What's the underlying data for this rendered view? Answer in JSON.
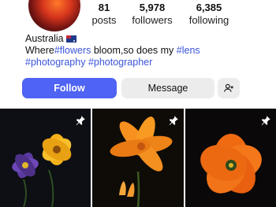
{
  "profile": {
    "stats": [
      {
        "value": "81",
        "label": "posts"
      },
      {
        "value": "5,978",
        "label": "followers"
      },
      {
        "value": "6,385",
        "label": "following"
      }
    ],
    "bio": {
      "location": "Australia",
      "line2_prefix": "Where",
      "line2_tag1": "#flowers",
      "line2_mid": " bloom,so does my ",
      "line2_tag2": "#lens",
      "line3_tag1": "#photography",
      "line3_tag2": "#photographer"
    }
  },
  "actions": {
    "follow_label": "Follow",
    "message_label": "Message",
    "add_user_icon": "person-add-icon"
  },
  "posts": [
    {
      "subject": "purple and yellow flowers",
      "pinned": true
    },
    {
      "subject": "orange lilies",
      "pinned": true
    },
    {
      "subject": "orange poppy",
      "pinned": true
    }
  ],
  "colors": {
    "accent": "#4f64f4",
    "hashtag": "#3b55d9",
    "secondary_button": "#ececec"
  }
}
